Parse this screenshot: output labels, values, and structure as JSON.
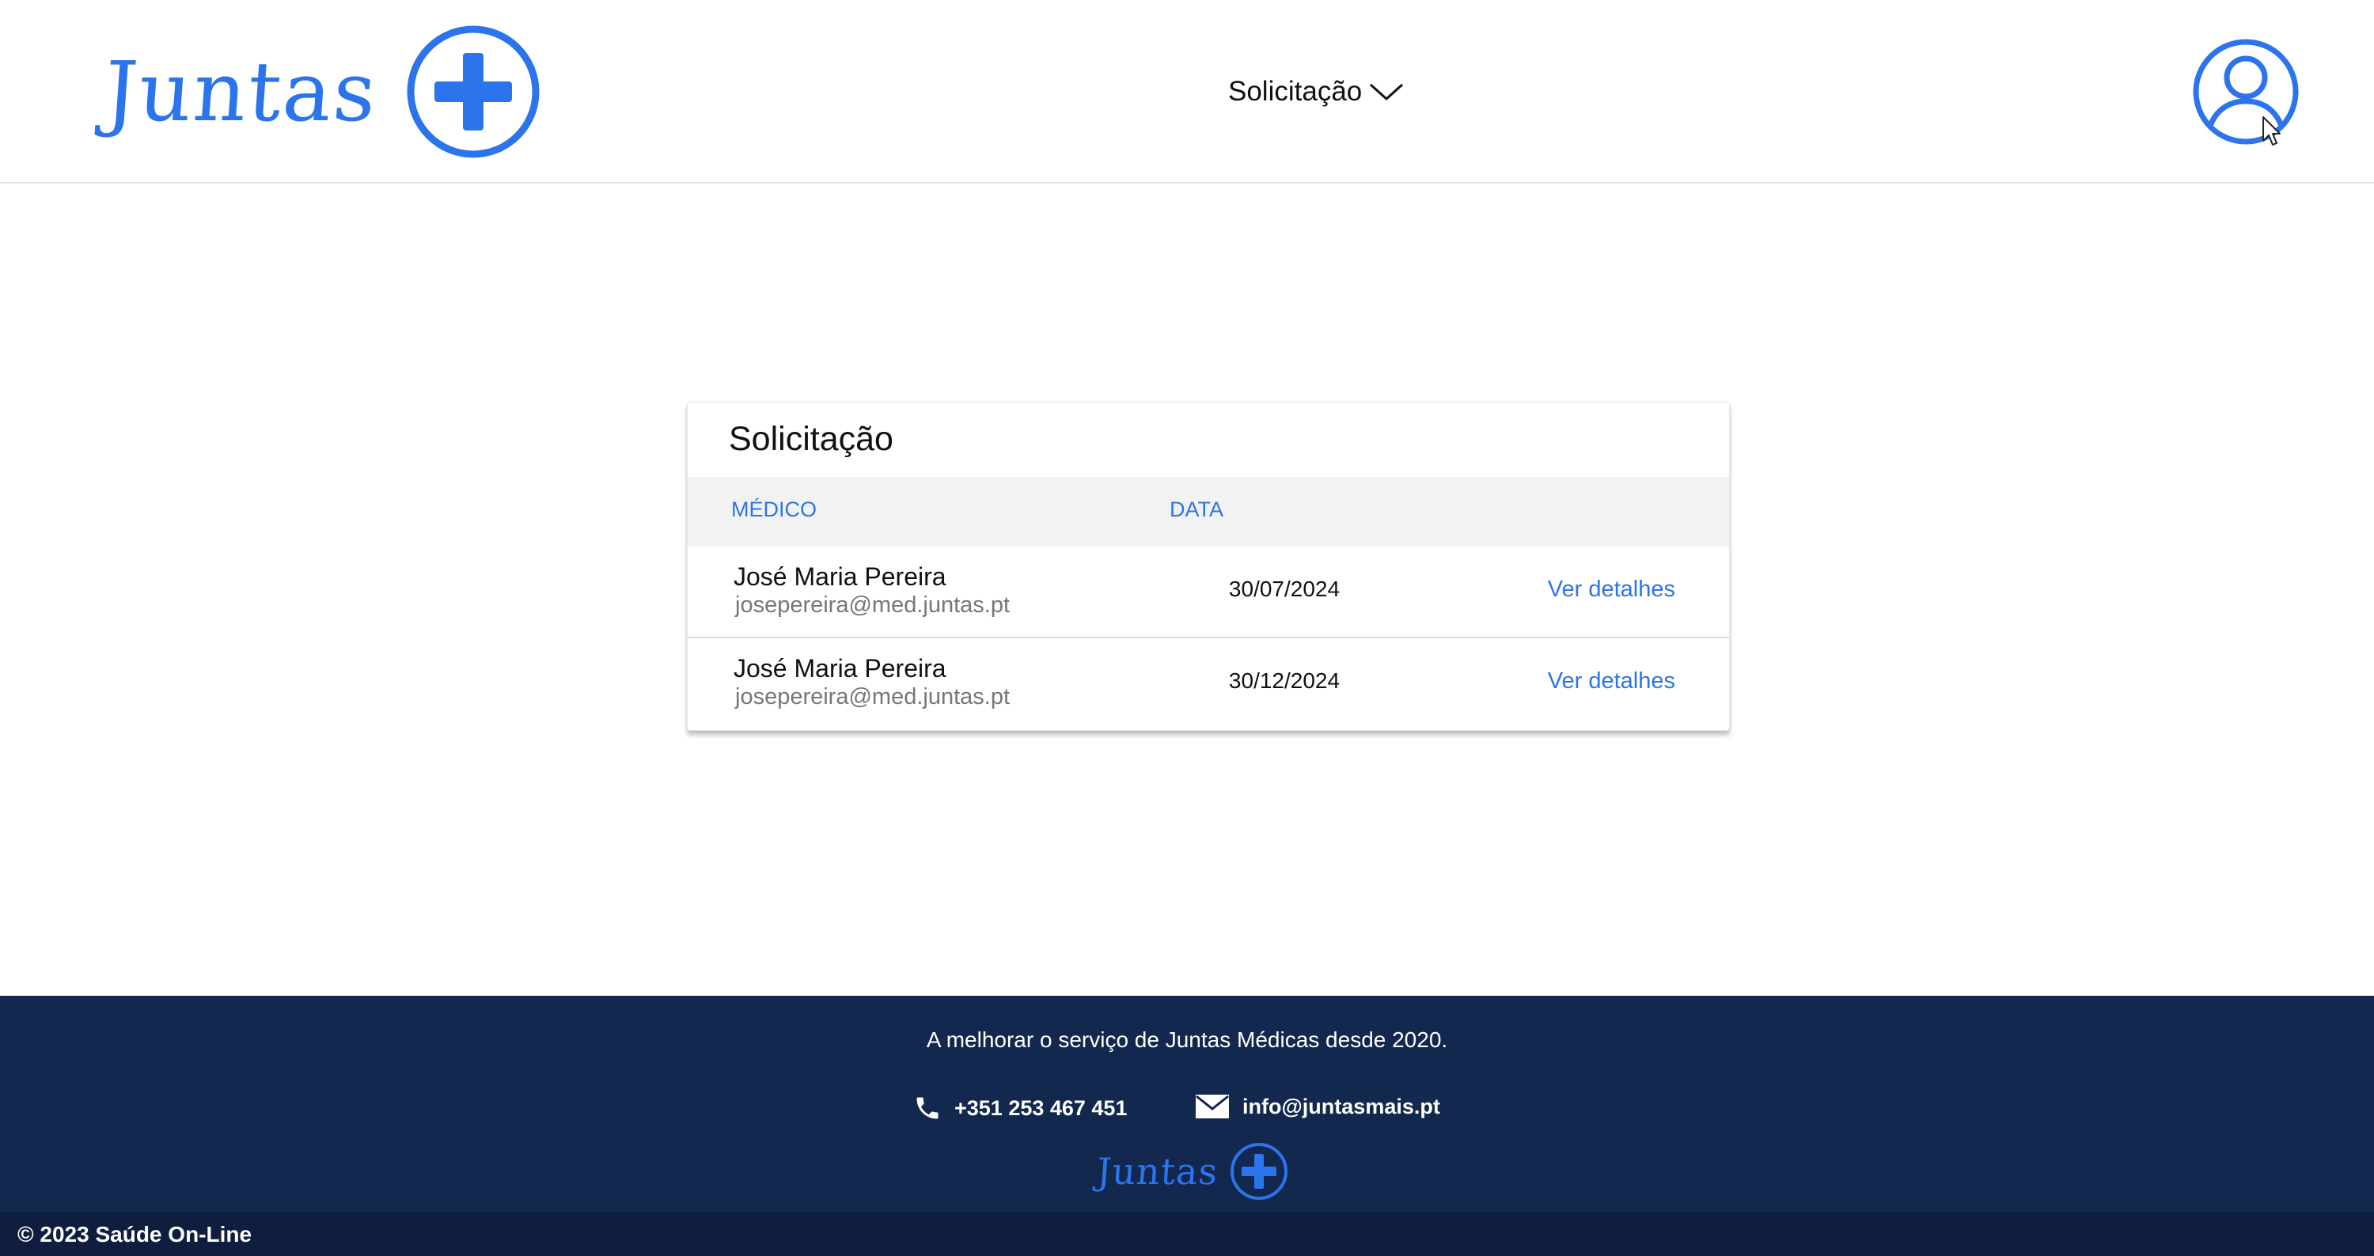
{
  "header": {
    "logo_text": "Juntas",
    "nav_label": "Solicitação",
    "icons": {
      "logo": "plus-circle-icon",
      "nav": "chevron-down-icon",
      "user": "user-circle-icon"
    }
  },
  "card": {
    "title": "Solicitação",
    "columns": {
      "medico": "MÉDICO",
      "data": "DATA"
    },
    "rows": [
      {
        "name": "José Maria Pereira",
        "email": "josepereira@med.juntas.pt",
        "date": "30/07/2024",
        "action": "Ver detalhes"
      },
      {
        "name": "José Maria Pereira",
        "email": "josepereira@med.juntas.pt",
        "date": "30/12/2024",
        "action": "Ver detalhes"
      }
    ]
  },
  "footer": {
    "tagline": "A melhorar o serviço de Juntas Médicas desde 2020.",
    "phone": "+351 253 467 451",
    "email": "info@juntasmais.pt",
    "logo_text": "Juntas",
    "copyright": "© 2023 Saúde On-Line"
  },
  "colors": {
    "accent": "#2c74ec",
    "footer_bg": "#12284f",
    "bottom_bar_bg": "#0f1e3e",
    "table_head_bg": "#f2f2f2"
  }
}
